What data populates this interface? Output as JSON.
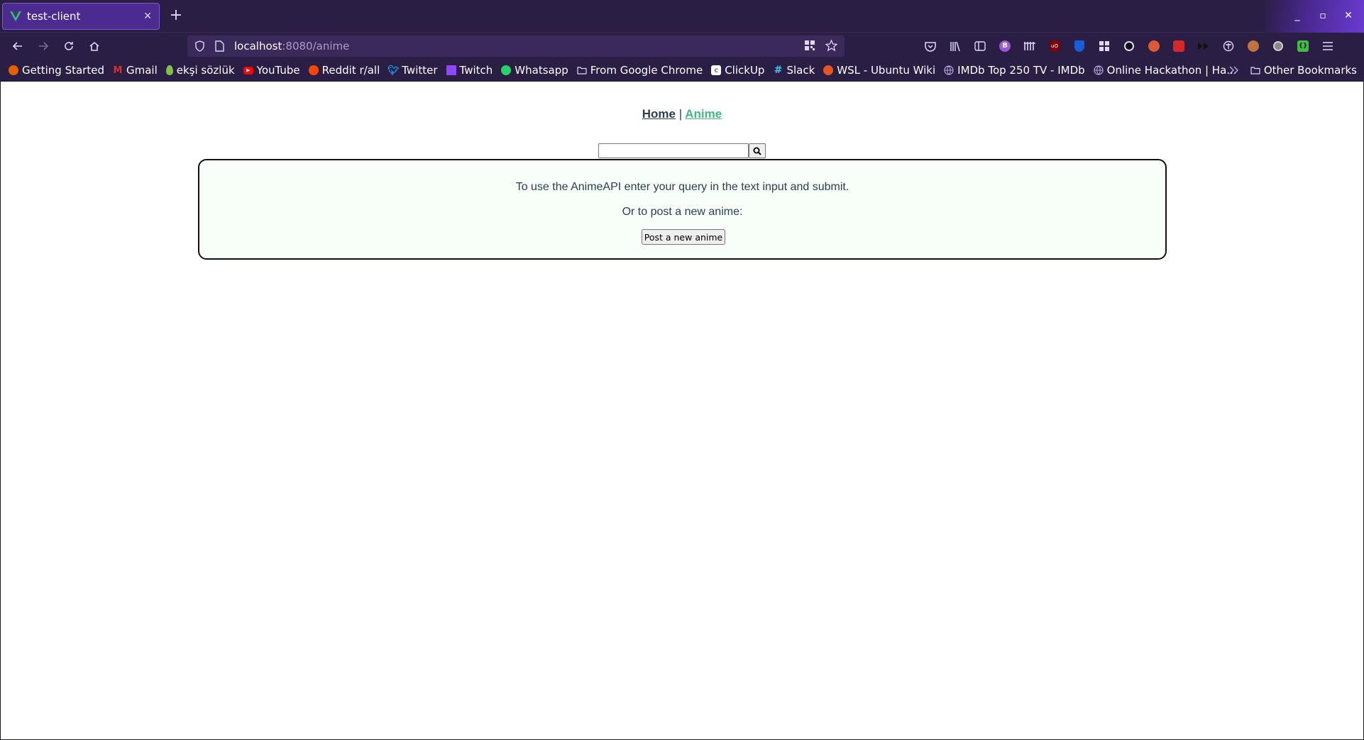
{
  "browser": {
    "tab": {
      "title": "test-client",
      "favicon": "vue-logo-icon",
      "close_glyph": "✕"
    },
    "new_tab_glyph": "+",
    "window_controls": {
      "minimize": "_",
      "maximize": "▫",
      "close": "✕"
    },
    "url": {
      "host": "localhost",
      "rest": ":8080/anime"
    },
    "bookmarks": [
      {
        "label": "Getting Started",
        "icon": "firefox-icon",
        "color": "#e66000"
      },
      {
        "label": "Gmail",
        "icon": "gmail-icon",
        "color": "#d93025"
      },
      {
        "label": "ekşi sözlük",
        "icon": "eksi-drop-icon",
        "color": "#81c14b"
      },
      {
        "label": "YouTube",
        "icon": "youtube-icon",
        "color": "#ff0000"
      },
      {
        "label": "Reddit r/all",
        "icon": "reddit-icon",
        "color": "#ff4500"
      },
      {
        "label": "Twitter",
        "icon": "twitter-icon",
        "color": "#1da1f2"
      },
      {
        "label": "Twitch",
        "icon": "twitch-icon",
        "color": "#9146ff"
      },
      {
        "label": "Whatsapp",
        "icon": "whatsapp-icon",
        "color": "#25d366"
      },
      {
        "label": "From Google Chrome",
        "icon": "folder-icon",
        "color": "#e0d8f5"
      },
      {
        "label": "ClickUp",
        "icon": "clickup-icon",
        "color": "#7b68ee"
      },
      {
        "label": "Slack",
        "icon": "slack-icon",
        "color": "#36c5f0"
      },
      {
        "label": "WSL - Ubuntu Wiki",
        "icon": "ubuntu-icon",
        "color": "#e95420"
      },
      {
        "label": "IMDb Top 250 TV - IMDb",
        "icon": "globe-icon",
        "color": "#b8a9e0"
      },
      {
        "label": "Online Hackathon | Ha...",
        "icon": "globe-icon",
        "color": "#b8a9e0"
      }
    ],
    "other_bookmarks": "Other Bookmarks"
  },
  "app": {
    "nav": {
      "home": "Home",
      "separator": "|",
      "anime": "Anime"
    },
    "search": {
      "value": "",
      "placeholder": ""
    },
    "info": {
      "line1": "To use the AnimeAPI enter your query in the text input and submit.",
      "line2": "Or to post a new anime:",
      "post_button": "Post a new anime"
    }
  },
  "colors": {
    "browser_chrome": "#2b1e45",
    "accent_link": "#42b983",
    "text": "#2c3e50",
    "info_bg": "#f8fff8"
  }
}
